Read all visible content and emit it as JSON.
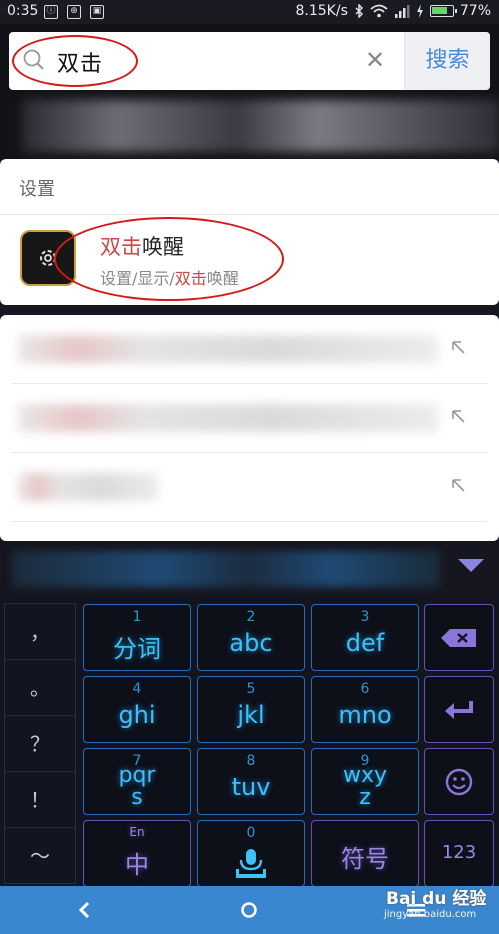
{
  "status_bar": {
    "time": "0:35",
    "notifications": [
      "ⓘ",
      "⊕",
      "▣"
    ],
    "net_speed": "8.15K/s",
    "battery_percent": "77%",
    "battery_level": 0.77
  },
  "search": {
    "query": "双击",
    "search_button_label": "搜索"
  },
  "settings_section": {
    "title": "设置",
    "result": {
      "title_highlight": "双击",
      "title_rest": "唤醒",
      "path_prefix": "设置/显示/",
      "path_highlight": "双击",
      "path_rest": "唤醒"
    }
  },
  "keyboard": {
    "punctuation": [
      "，",
      "。",
      "？",
      "！",
      "～"
    ],
    "keys": [
      {
        "num": "1",
        "label": "分词"
      },
      {
        "num": "2",
        "label": "abc"
      },
      {
        "num": "3",
        "label": "def"
      },
      {
        "num": "4",
        "label": "ghi"
      },
      {
        "num": "5",
        "label": "jkl"
      },
      {
        "num": "6",
        "label": "mno"
      },
      {
        "num": "7",
        "label": "pqr\ns"
      },
      {
        "num": "8",
        "label": "tuv"
      },
      {
        "num": "9",
        "label": "wxy\nz"
      }
    ],
    "bottom": {
      "lang_sub": "En",
      "lang_main": "中",
      "space_num": "0",
      "symbols": "符号",
      "numeric": "123"
    }
  },
  "watermark": {
    "brand": "Bai du 经验",
    "url": "jingyan.baidu.com"
  },
  "colors": {
    "highlight": "#d24545",
    "search_button": "#4a88d8",
    "key_blue": "#3ec1f5",
    "key_purple": "#9a86e8",
    "nav_bar": "#3a87cf",
    "annotation": "#d21a1a"
  }
}
